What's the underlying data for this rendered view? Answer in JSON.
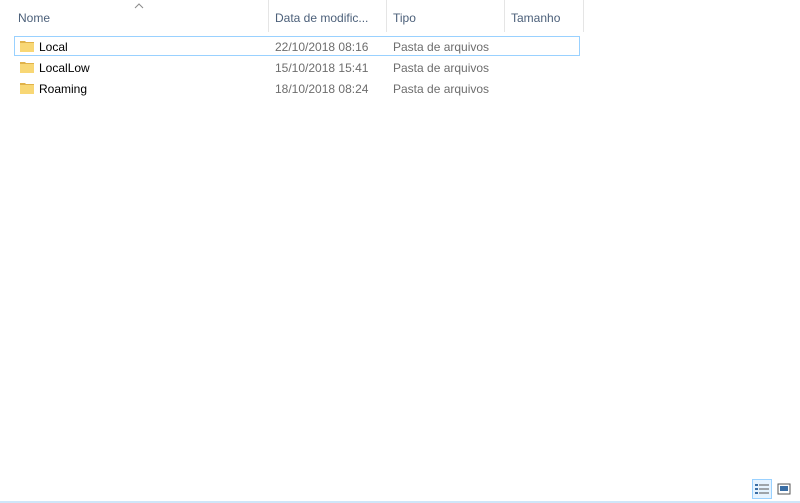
{
  "columns": {
    "name": "Nome",
    "date": "Data de modific...",
    "type": "Tipo",
    "size": "Tamanho"
  },
  "rows": [
    {
      "name": "Local",
      "date": "22/10/2018 08:16",
      "type": "Pasta de arquivos",
      "size": "",
      "icon": "folder-icon",
      "focused": true
    },
    {
      "name": "LocalLow",
      "date": "15/10/2018 15:41",
      "type": "Pasta de arquivos",
      "size": "",
      "icon": "folder-icon",
      "focused": false
    },
    {
      "name": "Roaming",
      "date": "18/10/2018 08:24",
      "type": "Pasta de arquivos",
      "size": "",
      "icon": "folder-icon",
      "focused": false
    }
  ],
  "view_buttons": [
    {
      "icon": "details-view-icon",
      "active": true
    },
    {
      "icon": "large-icons-view-icon",
      "active": false
    }
  ],
  "colors": {
    "folder": "#f8d775",
    "folder_dark": "#e0b24a",
    "header_text": "#4c607a",
    "secondary_text": "#6d6d6d",
    "selection_border": "#99d1ff"
  }
}
